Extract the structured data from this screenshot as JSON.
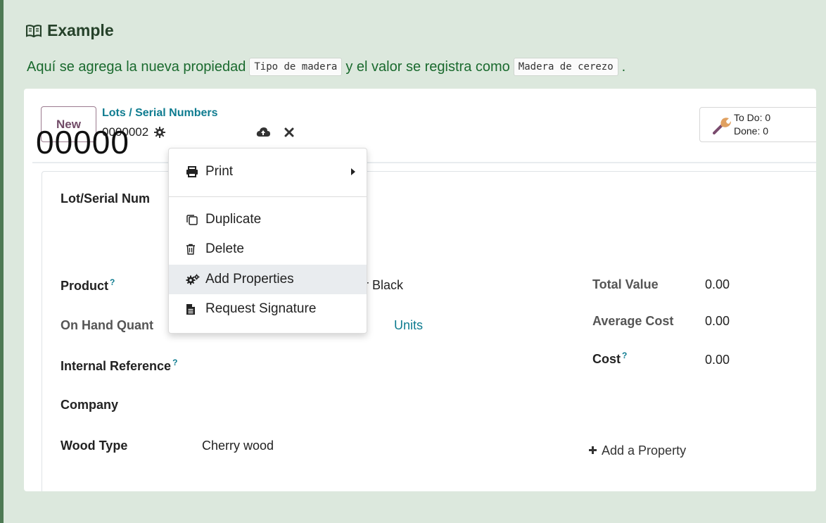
{
  "admonition": {
    "title": "Example",
    "text_before": "Aquí se agrega la nueva propiedad",
    "code1": "Tipo de madera",
    "text_middle": "y el valor se registra como",
    "code2": "Madera de cerezo",
    "text_after": "."
  },
  "header": {
    "new_button": "New",
    "breadcrumb": "Lots / Serial Numbers",
    "record_name": "0000002"
  },
  "activity": {
    "todo": "To Do: 0",
    "done": "Done: 0"
  },
  "menu": {
    "print": "Print",
    "duplicate": "Duplicate",
    "delete": "Delete",
    "add_properties": "Add Properties",
    "request_signature": "Request Signature"
  },
  "form": {
    "lot_label": "Lot/Serial Num",
    "lot_value": "00000",
    "product_label": "Product",
    "product_help": "?",
    "product_value_partial": "r Black",
    "onhand_label": "On Hand Quant",
    "onhand_uom": "Units",
    "internal_ref_label": "Internal Reference",
    "internal_ref_help": "?",
    "company_label": "Company",
    "wood_type_label": "Wood Type",
    "wood_type_value": "Cherry wood",
    "total_value_label": "Total Value",
    "total_value": "0.00",
    "average_cost_label": "Average Cost",
    "average_cost": "0.00",
    "cost_label": "Cost",
    "cost_help": "?",
    "cost": "0.00",
    "add_property": "Add a Property"
  },
  "colors": {
    "admonition_bg": "#dce8dd",
    "admonition_text": "#1a6a2e",
    "link_teal": "#0f7c90",
    "brand_purple": "#714b67"
  }
}
